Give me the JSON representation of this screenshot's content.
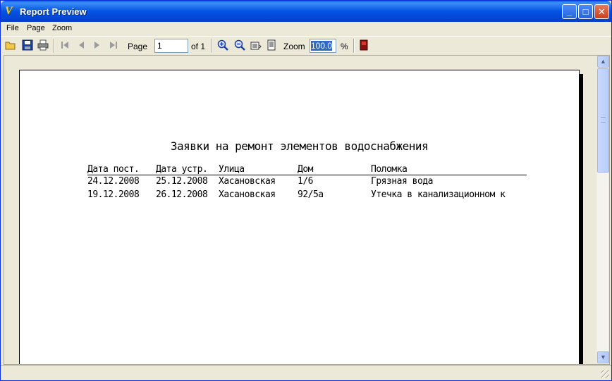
{
  "window": {
    "title": "Report Preview",
    "controls": [
      "_",
      "□",
      "✕"
    ]
  },
  "menu": [
    "File",
    "Page",
    "Zoom"
  ],
  "toolbar": {
    "icons": [
      "open-icon",
      "save-icon",
      "print-icon",
      "first-page-icon",
      "prev-page-icon",
      "next-page-icon",
      "last-page-icon",
      "zoom-in-icon",
      "zoom-out-icon",
      "page-width-icon",
      "whole-page-icon",
      "exit-icon"
    ],
    "page_label": "Page",
    "page_value": "1",
    "page_of": "of 1",
    "zoom_label": "Zoom",
    "zoom_value": "100.0",
    "zoom_unit": "%"
  },
  "report": {
    "title": "Заявки на ремонт элементов водоснабжения",
    "columns": [
      "Дата пост.",
      "Дата устр.",
      "Улица",
      "Дом",
      "Поломка"
    ],
    "rows": [
      [
        "24.12.2008",
        "25.12.2008",
        "Хасановская",
        "1/6",
        "Грязная вода"
      ],
      [
        "19.12.2008",
        "26.12.2008",
        "Хасановская",
        "92/5а",
        "Утечка в канализационном к"
      ]
    ]
  },
  "colors": {
    "titlebar": "#0453e2",
    "chrome": "#ece9d8",
    "selection": "#316ac5"
  }
}
